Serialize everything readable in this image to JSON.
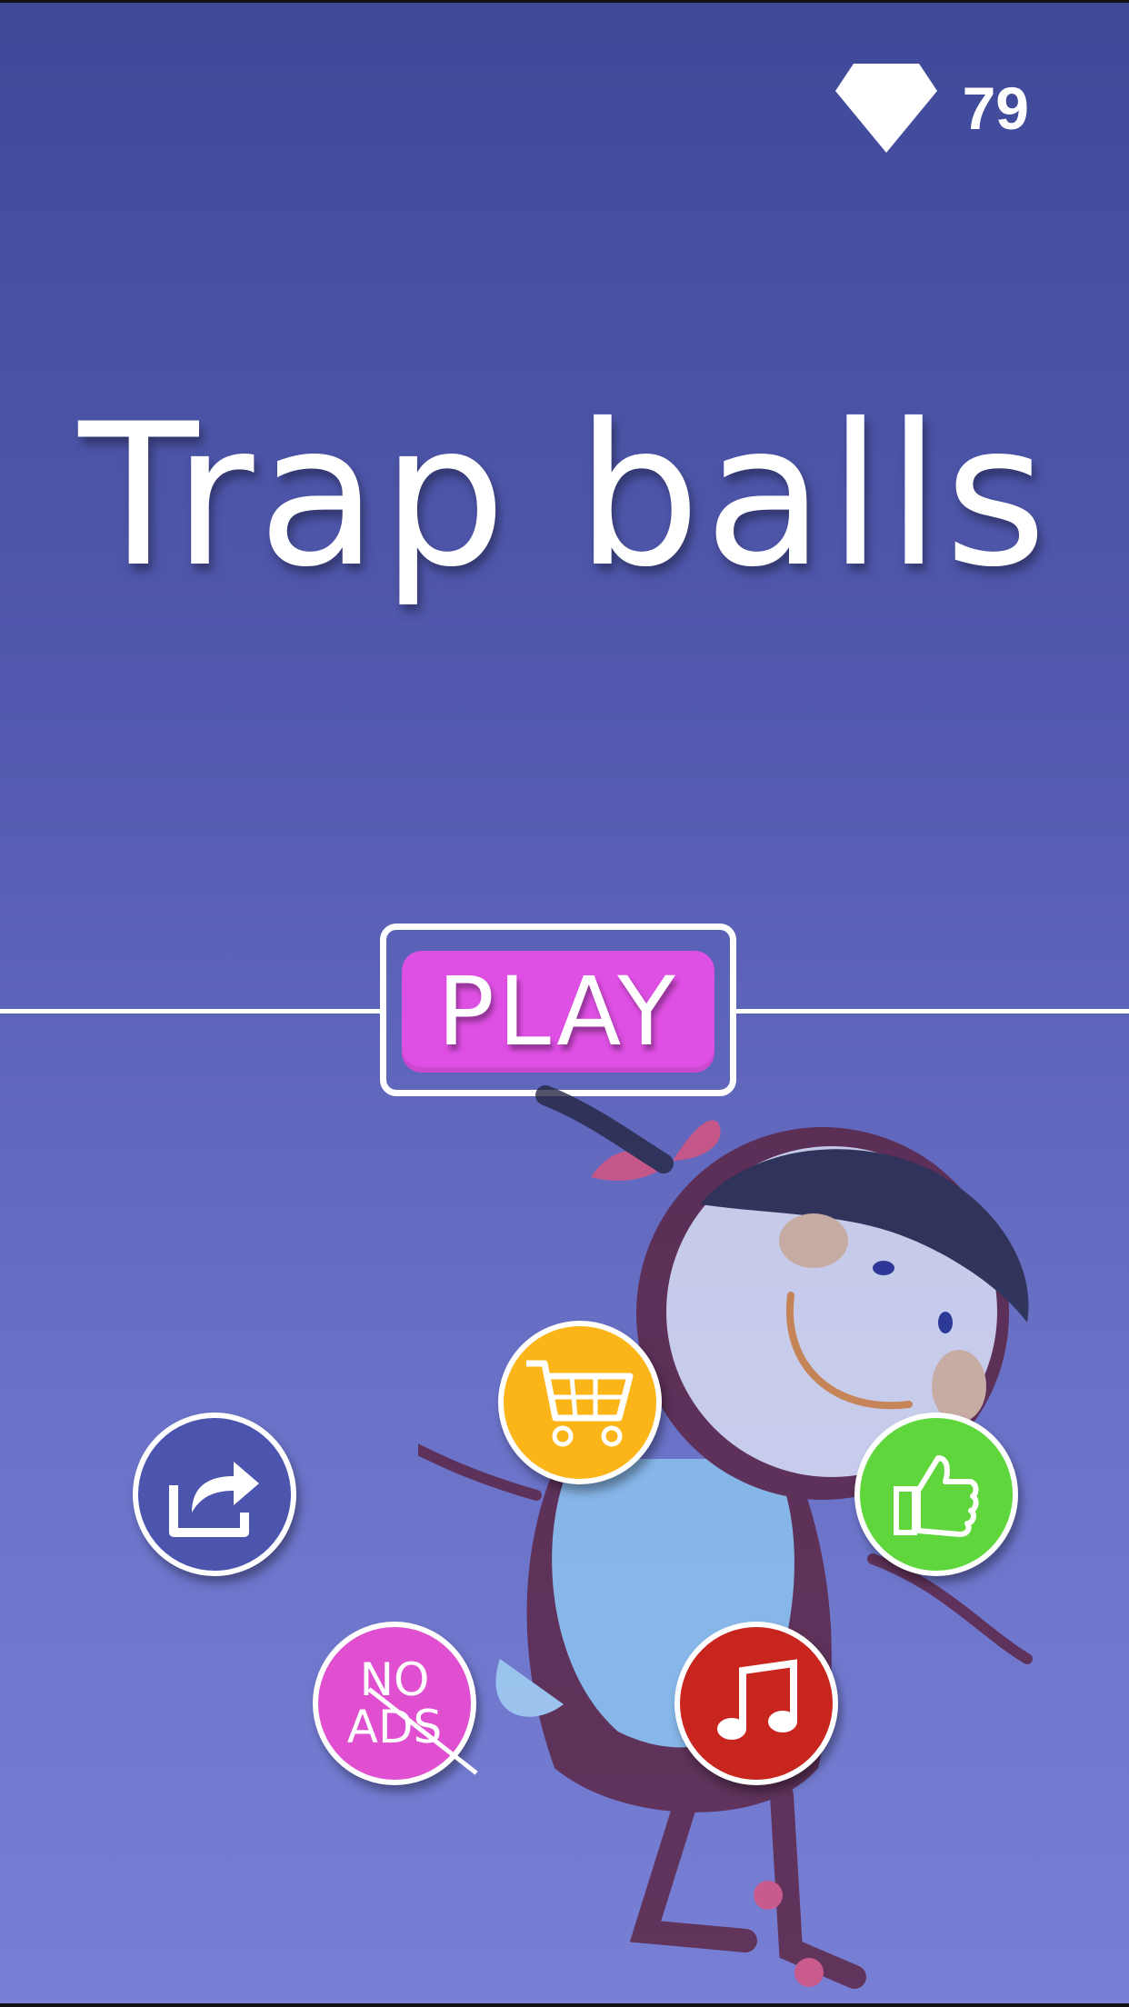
{
  "app": {
    "title": "Trap balls"
  },
  "hud": {
    "gems": "79",
    "gem_icon": "diamond-icon"
  },
  "menu": {
    "play_label": "PLAY",
    "noads_label": "NO\nADS",
    "buttons": {
      "share_icon": "share-icon",
      "shop_icon": "cart-icon",
      "like_icon": "thumbs-up-icon",
      "noads_icon": "no-ads-icon",
      "music_icon": "music-note-icon"
    }
  },
  "colors": {
    "background_top": "#3f4998",
    "background_bottom": "#7880d6",
    "play": "#de4fe3",
    "share": "#4c55ad",
    "shop": "#fbb518",
    "like": "#5fd63c",
    "noads": "#e04fcf",
    "music": "#c8251e"
  }
}
